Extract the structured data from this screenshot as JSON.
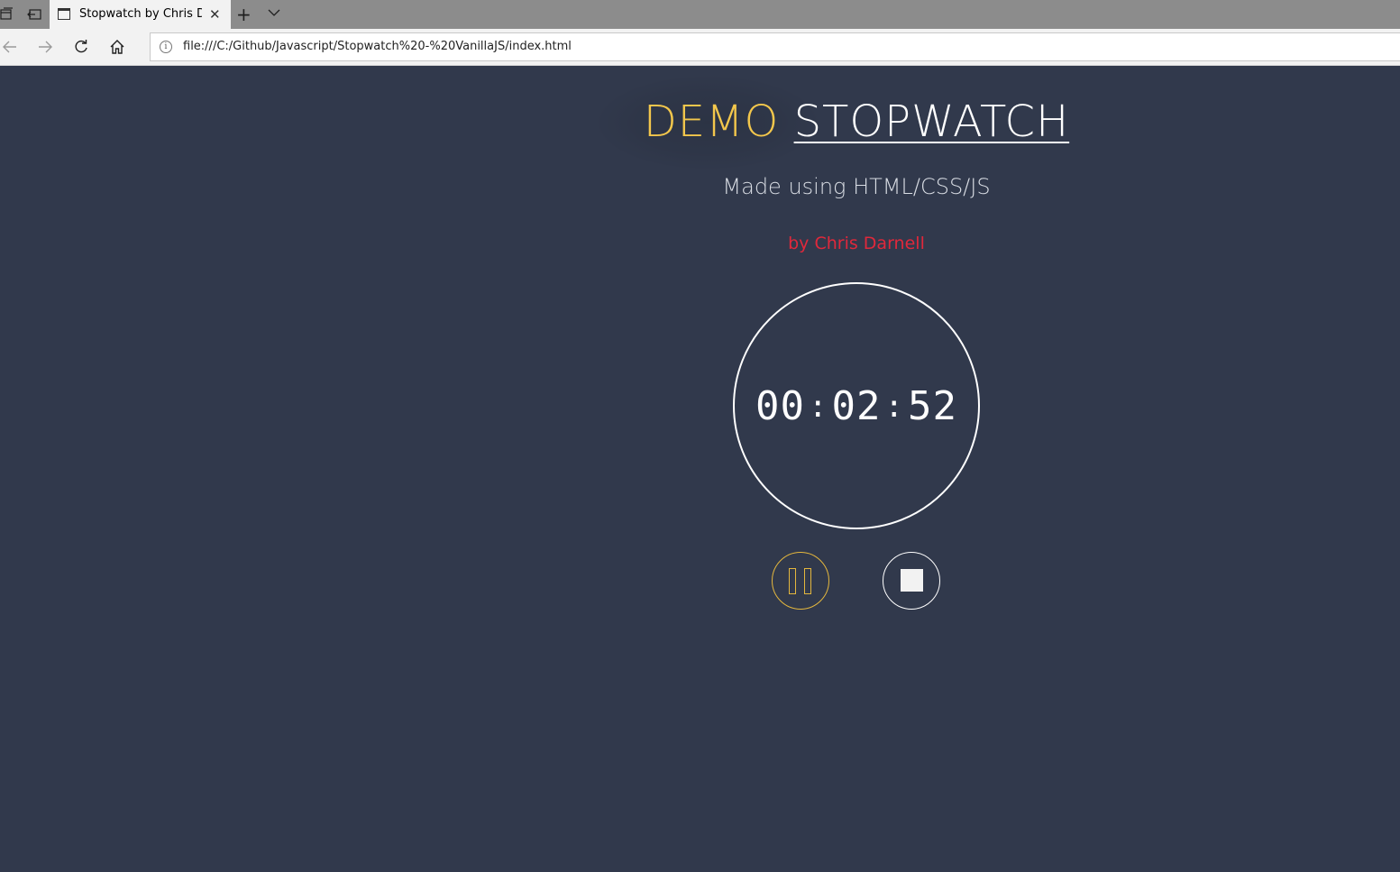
{
  "browser": {
    "tab_title": "Stopwatch by Chris Darnell",
    "tab_close": "✕",
    "new_tab": "+",
    "url": "file:///C:/Github/Javascript/Stopwatch%20-%20VanillaJS/index.html",
    "info_glyph": "i"
  },
  "page": {
    "title_left": "DEMO",
    "title_right": "STOPWATCH",
    "subtitle": "Made using HTML/CSS/JS",
    "author": "by Chris Darnell",
    "timer": {
      "hours": "00",
      "minutes": "02",
      "seconds": "52",
      "separator": ":"
    },
    "controls": {
      "pause_icon": "pause-icon",
      "stop_icon": "stop-icon"
    },
    "colors": {
      "background": "#31394c",
      "accent_gold": "#f3c74c",
      "author_red": "#e0283b",
      "white": "#ffffff"
    }
  }
}
